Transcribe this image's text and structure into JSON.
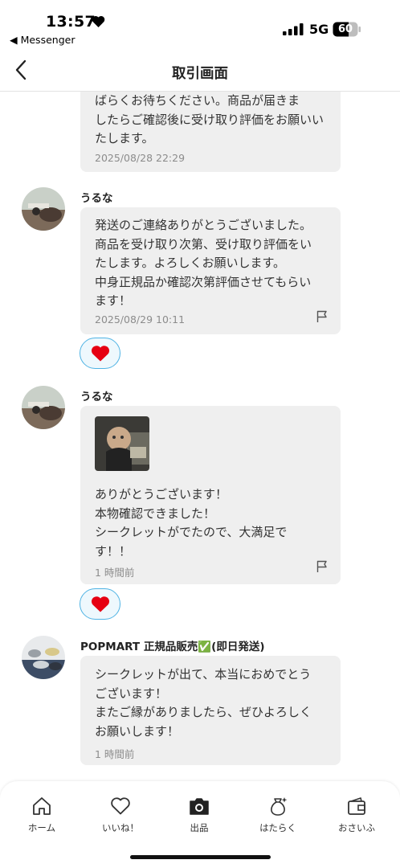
{
  "status_bar": {
    "time": "13:57",
    "back_app": "◀ Messenger",
    "network": "5G",
    "battery": "60"
  },
  "header": {
    "title": "取引画面"
  },
  "messages": [
    {
      "text": "ばらくお待ちください。商品が届きま\nしたらご確認後に受け取り評価をお願いい\nたします。",
      "timestamp": "2025/08/28 22:29"
    },
    {
      "sender": "うるな",
      "text": "発送のご連絡ありがとうございました。\n商品を受け取り次第、受け取り評価をい\nたします。よろしくお願いします。\n中身正規品か確認次第評価させてもらい\nます！",
      "timestamp": "2025/08/29 10:11",
      "reaction": "heart"
    },
    {
      "sender": "うるな",
      "text": "ありがとうございます！\n本物確認できました！\nシークレットがでたので、大満足で\nす！！",
      "timestamp": "1 時間前",
      "reaction": "heart"
    },
    {
      "sender": "POPMART 正規品販売✅(即日発送)",
      "text": "シークレットが出て、本当におめでとう\nございます！\nまたご縁がありましたら、ぜひよろしく\nお願いします！",
      "timestamp": "1 時間前"
    }
  ],
  "tabs": [
    {
      "label": "ホーム",
      "icon": "home-icon"
    },
    {
      "label": "いいね！",
      "icon": "heart-icon"
    },
    {
      "label": "出品",
      "icon": "camera-icon"
    },
    {
      "label": "はたらく",
      "icon": "money-bag-icon"
    },
    {
      "label": "おさいふ",
      "icon": "wallet-icon"
    }
  ],
  "colors": {
    "bubble": "#efefef",
    "reaction_border": "#4fb3e4",
    "heart": "#e60012"
  }
}
